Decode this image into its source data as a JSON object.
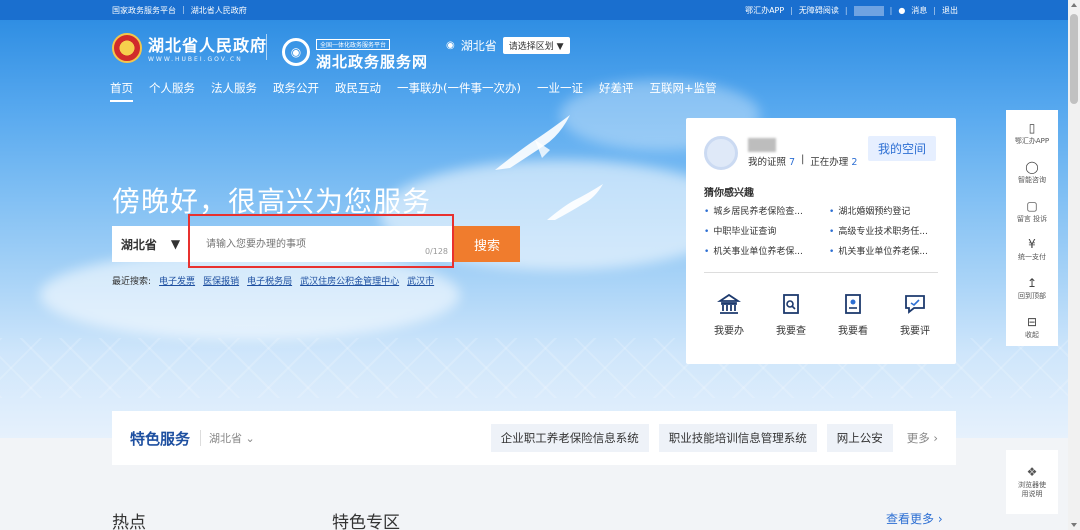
{
  "topbar": {
    "left_links": [
      "国家政务服务平台",
      "湖北省人民政府"
    ],
    "right_links": [
      "鄂汇办APP",
      "无障碍阅读"
    ],
    "message": "消息",
    "logout": "退出",
    "message_icon": "bell-icon"
  },
  "header": {
    "gov_title": "湖北省人民政府",
    "gov_domain": "WWW.HUBEI.GOV.CN",
    "portal_badge": "全国一体化政务服务平台",
    "portal_title": "湖北政务服务网",
    "location": "湖北省",
    "region_button": "请选择区划"
  },
  "nav": {
    "items": [
      "首页",
      "个人服务",
      "法人服务",
      "政务公开",
      "政民互动",
      "一事联办(一件事一次办)",
      "一业一证",
      "好差评",
      "互联网+监管"
    ],
    "active": "首页"
  },
  "hero": {
    "greeting": "傍晚好，很高兴为您服务",
    "province": "湖北省",
    "search_placeholder": "请输入您要办理的事项",
    "char_count": "0/128",
    "search_button": "搜索",
    "recent_label": "最近搜索:",
    "recent_items": [
      "电子发票",
      "医保报销",
      "电子税务局",
      "武汉住房公积金管理中心",
      "武汉市"
    ]
  },
  "user_card": {
    "cert_label": "我的证照",
    "cert_count": "7",
    "processing_label": "正在办理",
    "processing_count": "2",
    "my_space": "我的空间",
    "guess_title": "猜你感兴趣",
    "guess_items": [
      "城乡居民养老保险查...",
      "湖北婚姻预约登记",
      "中职毕业证查询",
      "高级专业技术职务任...",
      "机关事业单位养老保...",
      "机关事业单位养老保..."
    ],
    "actions": [
      {
        "label": "我要办",
        "icon": "building-icon"
      },
      {
        "label": "我要查",
        "icon": "search-doc-icon"
      },
      {
        "label": "我要看",
        "icon": "monitor-icon"
      },
      {
        "label": "我要评",
        "icon": "comment-icon"
      }
    ]
  },
  "tool_rail": {
    "items": [
      {
        "label": "鄂汇办APP",
        "icon": "phone-icon"
      },
      {
        "label": "智能咨询",
        "icon": "chat-bot-icon"
      },
      {
        "label": "留言 投诉",
        "icon": "message-icon"
      },
      {
        "label": "统一支付",
        "icon": "yuan-icon"
      },
      {
        "label": "回到顶部",
        "icon": "back-to-top-icon"
      },
      {
        "label": "收起",
        "icon": "collapse-icon"
      }
    ],
    "browser_help": "浏览器使用说明"
  },
  "features": {
    "title_part1": "特色",
    "title_part2": "服务",
    "region": "湖北省",
    "links": [
      "企业职工养老保险信息系统",
      "职业技能培训信息管理系统",
      "网上公安"
    ],
    "more": "更多"
  },
  "sections": {
    "hot": "热点",
    "special": "特色专区",
    "see_more": "查看更多"
  },
  "colors": {
    "primary": "#1a6fcf",
    "accent": "#f07c2d",
    "highlight": "#e8312f",
    "link": "#2d6fd3"
  }
}
